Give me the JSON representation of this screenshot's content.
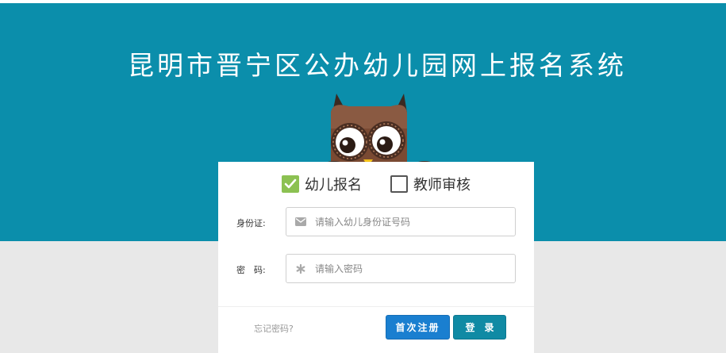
{
  "header": {
    "title": "昆明市晋宁区公办幼儿园网上报名系统"
  },
  "colors": {
    "banner": "#0b8eab",
    "checked": "#8cc152",
    "register": "#1a7fd0",
    "login": "#108aa4"
  },
  "login": {
    "roles": [
      {
        "label": "幼儿报名",
        "checked": true
      },
      {
        "label": "教师审核",
        "checked": false
      }
    ],
    "id_label": "身份证:",
    "id_placeholder": "请输入幼儿身份证号码",
    "id_icon": "envelope-icon",
    "password_label": "密　码:",
    "password_placeholder": "请输入密码",
    "password_icon": "asterisk-icon",
    "forgot": "忘记密码?",
    "register_button": "首次注册",
    "login_button": "登录"
  }
}
